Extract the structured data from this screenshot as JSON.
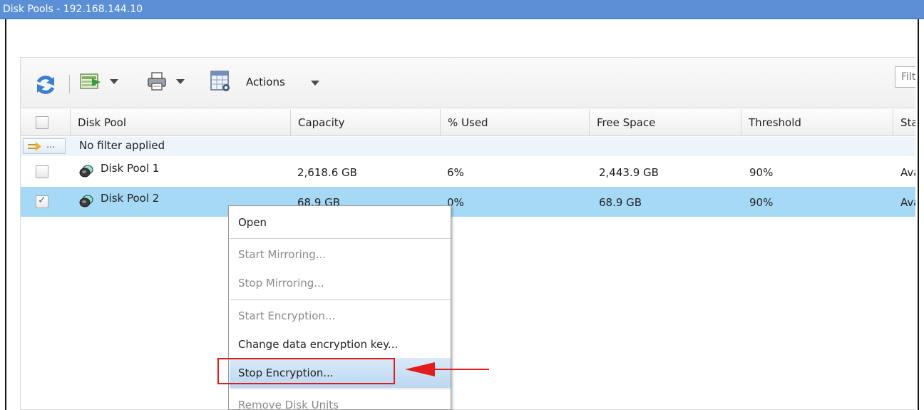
{
  "window": {
    "title": "Disk Pools - 192.168.144.10"
  },
  "toolbar": {
    "refresh_icon": "refresh-icon",
    "export_icon": "export-icon",
    "print_icon": "print-icon",
    "columns_icon": "columns-icon",
    "actions_label": "Actions",
    "filter_placeholder": "Filt"
  },
  "table": {
    "columns": [
      "Disk Pool",
      "Capacity",
      "% Used",
      "Free Space",
      "Threshold",
      "Sta"
    ],
    "filter_text": "No filter applied",
    "filter_toggle": "...",
    "rows": [
      {
        "name": "Disk Pool 1",
        "capacity": "2,618.6 GB",
        "used": "6%",
        "free": "2,443.9 GB",
        "threshold": "90%",
        "status": "Ava",
        "checked": false
      },
      {
        "name": "Disk Pool 2",
        "capacity": "68.9 GB",
        "used": "0%",
        "free": "68.9 GB",
        "threshold": "90%",
        "status": "Ava",
        "checked": true
      }
    ]
  },
  "context_menu": {
    "items": [
      {
        "label": "Open",
        "enabled": true
      },
      {
        "label": "Start Mirroring...",
        "enabled": false
      },
      {
        "label": "Stop Mirroring...",
        "enabled": false
      },
      {
        "label": "Start Encryption...",
        "enabled": false
      },
      {
        "label": "Change data encryption key...",
        "enabled": true
      },
      {
        "label": "Stop Encryption...",
        "enabled": true,
        "highlighted": true
      },
      {
        "label": "Remove Disk Units",
        "enabled": false
      }
    ]
  },
  "colors": {
    "titlebar": "#5b8fd6",
    "selected_row": "#a6d9f5",
    "annotation": "#e21b1b"
  }
}
